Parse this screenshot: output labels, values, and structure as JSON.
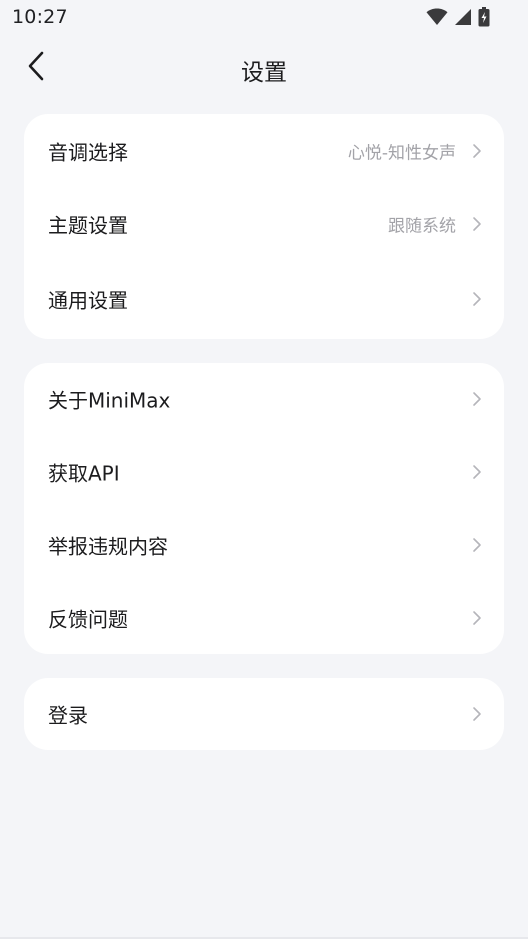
{
  "status_bar": {
    "time": "10:27",
    "icons": [
      "wifi-icon",
      "cellular-signal-icon",
      "battery-charging-icon"
    ]
  },
  "header": {
    "title": "设置",
    "back_icon": "chevron-left-icon"
  },
  "groups": [
    {
      "items": [
        {
          "label": "音调选择",
          "value": "心悦-知性女声"
        },
        {
          "label": "主题设置",
          "value": "跟随系统"
        },
        {
          "label": "通用设置",
          "value": ""
        }
      ]
    },
    {
      "items": [
        {
          "label": "关于MiniMax",
          "value": ""
        },
        {
          "label": "获取API",
          "value": ""
        },
        {
          "label": "举报违规内容",
          "value": ""
        },
        {
          "label": "反馈问题",
          "value": ""
        }
      ]
    },
    {
      "items": [
        {
          "label": "登录",
          "value": ""
        }
      ]
    }
  ],
  "colors": {
    "background": "#f4f5f8",
    "card": "#ffffff",
    "primary_text": "#1c1c1e",
    "secondary_text": "#a3a3a8",
    "chevron": "#b5b5ba"
  }
}
